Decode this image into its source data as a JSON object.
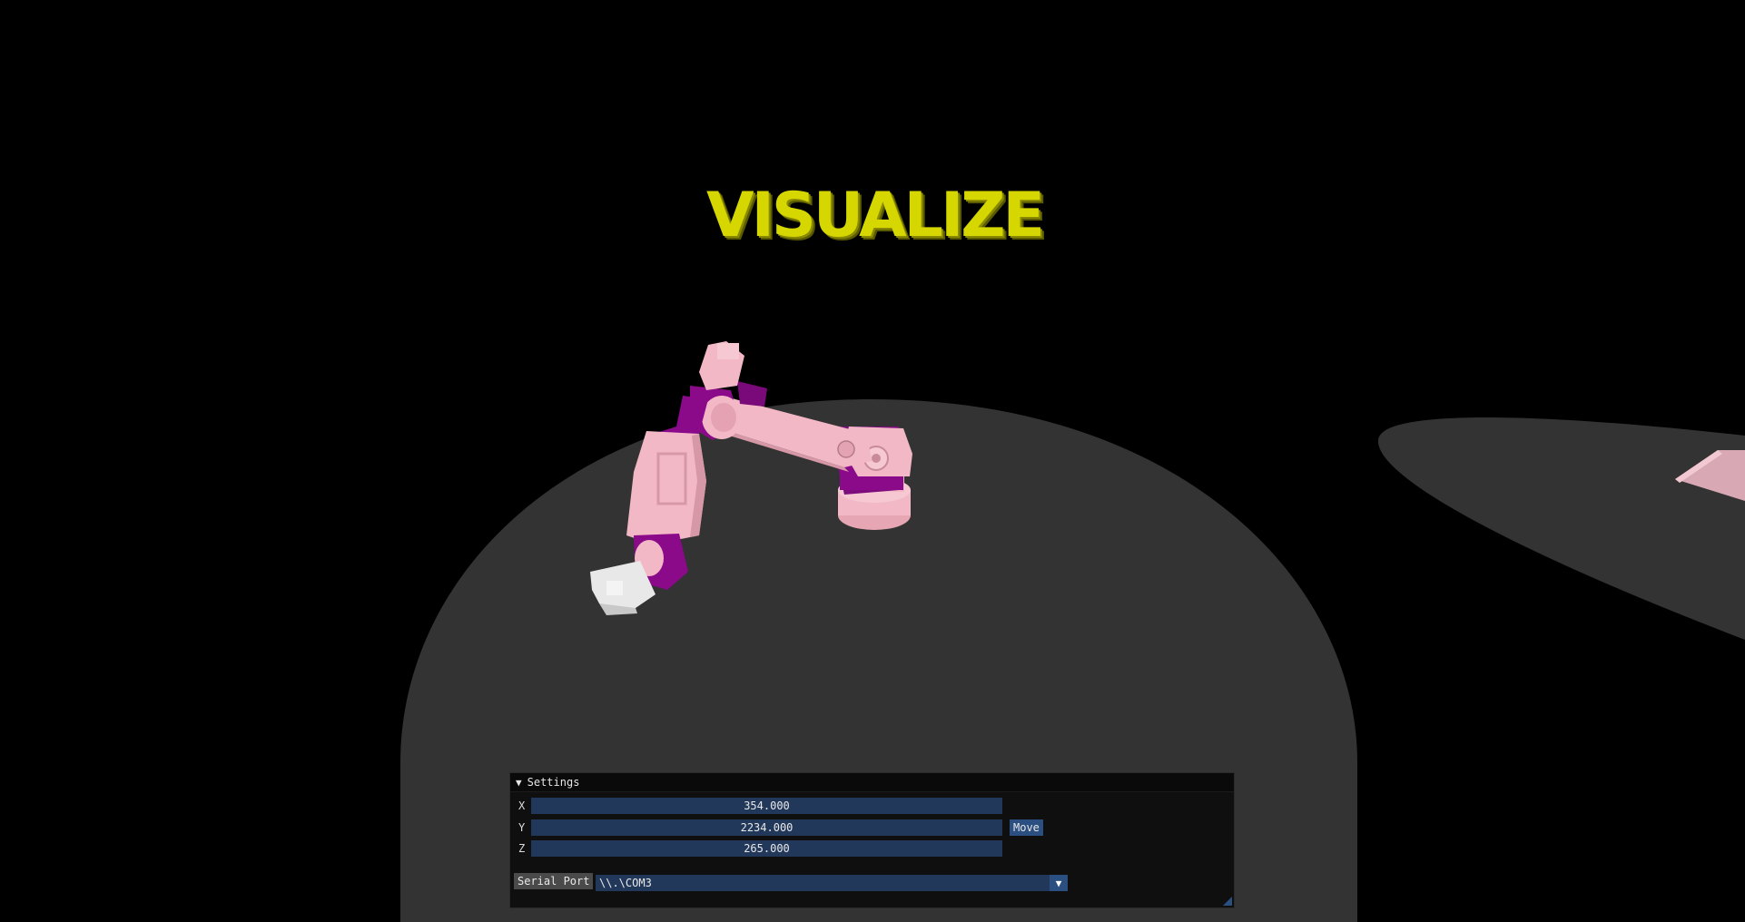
{
  "scene": {
    "title": "VISUALIZE",
    "background_color": "#000000",
    "floor_color": "#333333",
    "arm_color": "#f2b8c6",
    "joint_color": "#8a0a8a",
    "gripper_color": "#e8e8e8",
    "title_color": "#d6d600"
  },
  "settings": {
    "header": "Settings",
    "collapse_icon": "triangle-down-icon",
    "x_label": "X",
    "x_value": "354.000",
    "y_label": "Y",
    "y_value": "2234.000",
    "z_label": "Z",
    "z_value": "265.000",
    "move_label": "Move",
    "serial_port_label": "Serial Port",
    "serial_port_value": "\\\\.\\COM3",
    "dropdown_icon": "triangle-down-icon"
  }
}
